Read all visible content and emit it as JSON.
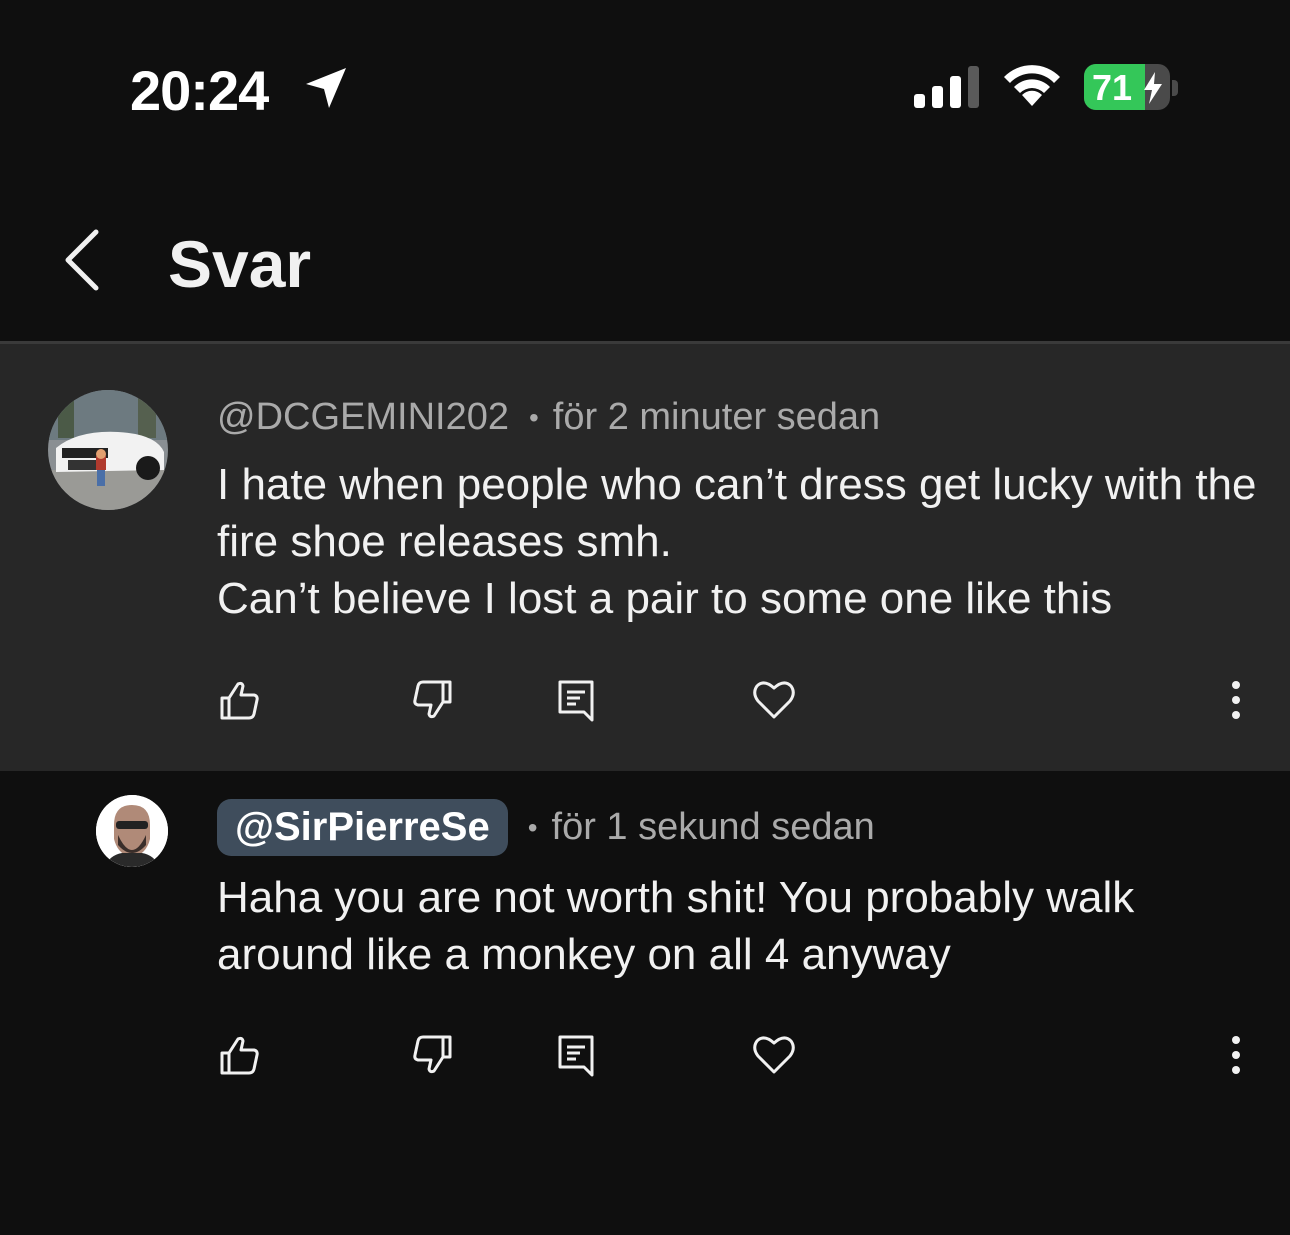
{
  "status_bar": {
    "time": "20:24",
    "battery": "71",
    "battery_level": 0.71,
    "icons": [
      "location-arrow-icon",
      "cellular-signal-icon",
      "wifi-icon",
      "battery-charging-icon"
    ]
  },
  "header": {
    "title": "Svar",
    "back_icon": "chevron-left-icon"
  },
  "comments": [
    {
      "handle": "@DCGEMINI202",
      "separator": "•",
      "time": "för 2 minuter sedan",
      "text": "I hate when people who can’t dress get lucky with the fire shoe releases smh.\nCan’t believe I lost a pair to some one like this",
      "avatar": "car-photo-avatar"
    },
    {
      "handle": "@SirPierreSe",
      "separator": "•",
      "time": "för 1 sekund sedan",
      "text": "Haha you are not worth shit! You probably walk around like a monkey on all 4 anyway",
      "avatar": "man-portrait-avatar"
    }
  ],
  "action_icons": [
    "thumbs-up-icon",
    "thumbs-down-icon",
    "reply-icon",
    "heart-icon",
    "more-vertical-icon"
  ],
  "colors": {
    "background": "#0f0f0f",
    "parent_background": "#272727",
    "handle_pill": "#3f4d5c",
    "battery_green": "#34c759"
  }
}
